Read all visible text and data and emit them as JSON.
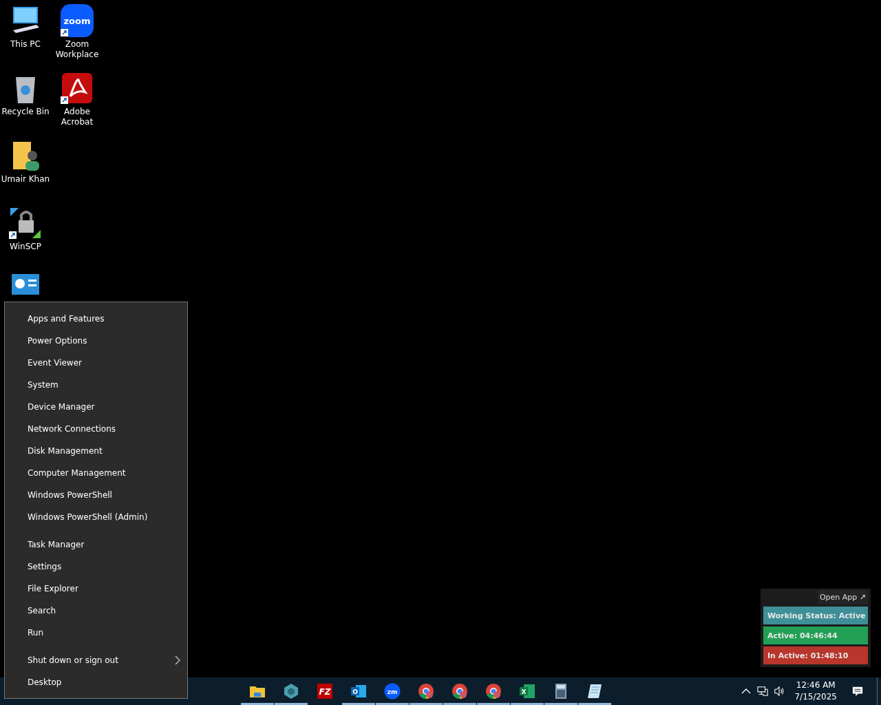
{
  "desktop_icons": [
    {
      "label": "This PC",
      "kind": "computer",
      "shortcut": false
    },
    {
      "label": "Recycle Bin",
      "kind": "bin",
      "shortcut": false
    },
    {
      "label": "Umair Khan",
      "kind": "userfolder",
      "shortcut": false
    },
    {
      "label": "WinSCP",
      "kind": "winscp",
      "shortcut": true
    },
    {
      "kind": "dashboard",
      "shortcut": false
    },
    {
      "label": "Zoom Workplace",
      "kind": "zoom",
      "shortcut": true,
      "glyph": "zoom"
    },
    {
      "label": "Adobe Acrobat",
      "kind": "acrobat",
      "shortcut": true
    }
  ],
  "context_menu": {
    "groups": [
      [
        {
          "label": "Apps and Features"
        },
        {
          "label": "Power Options"
        },
        {
          "label": "Event Viewer"
        },
        {
          "label": "System"
        },
        {
          "label": "Device Manager"
        },
        {
          "label": "Network Connections"
        },
        {
          "label": "Disk Management"
        },
        {
          "label": "Computer Management"
        },
        {
          "label": "Windows PowerShell"
        },
        {
          "label": "Windows PowerShell (Admin)"
        }
      ],
      [
        {
          "label": "Task Manager"
        },
        {
          "label": "Settings"
        },
        {
          "label": "File Explorer"
        },
        {
          "label": "Search"
        },
        {
          "label": "Run"
        }
      ],
      [
        {
          "label": "Shut down or sign out",
          "has_submenu": true
        },
        {
          "label": "Desktop",
          "has_submenu": false
        }
      ]
    ]
  },
  "status_widget": {
    "open_button": "Open App ↗",
    "rows": [
      {
        "text": "Working Status: Active",
        "color": "#3e8f98"
      },
      {
        "text": "Active: 04:46:44",
        "color": "#23a055"
      },
      {
        "text": "In Active: 01:48:10",
        "color": "#b8362c"
      }
    ]
  },
  "taskbar": {
    "apps": [
      {
        "kind": "folder",
        "running": true
      },
      {
        "kind": "hexagon",
        "running": true
      },
      {
        "kind": "filezilla",
        "running": false,
        "glyph": "FZ"
      },
      {
        "kind": "outlook",
        "running": true,
        "glyph": "O"
      },
      {
        "kind": "zoom",
        "running": true,
        "glyph": "zm"
      },
      {
        "kind": "chrome",
        "running": true
      },
      {
        "kind": "chrome",
        "running": true
      },
      {
        "kind": "chrome",
        "running": true
      },
      {
        "kind": "excel",
        "running": true,
        "glyph": "X"
      },
      {
        "kind": "calculator",
        "running": true
      },
      {
        "kind": "notepad",
        "running": true
      }
    ],
    "clock": {
      "time": "12:46 AM",
      "date": "7/15/2025"
    }
  }
}
